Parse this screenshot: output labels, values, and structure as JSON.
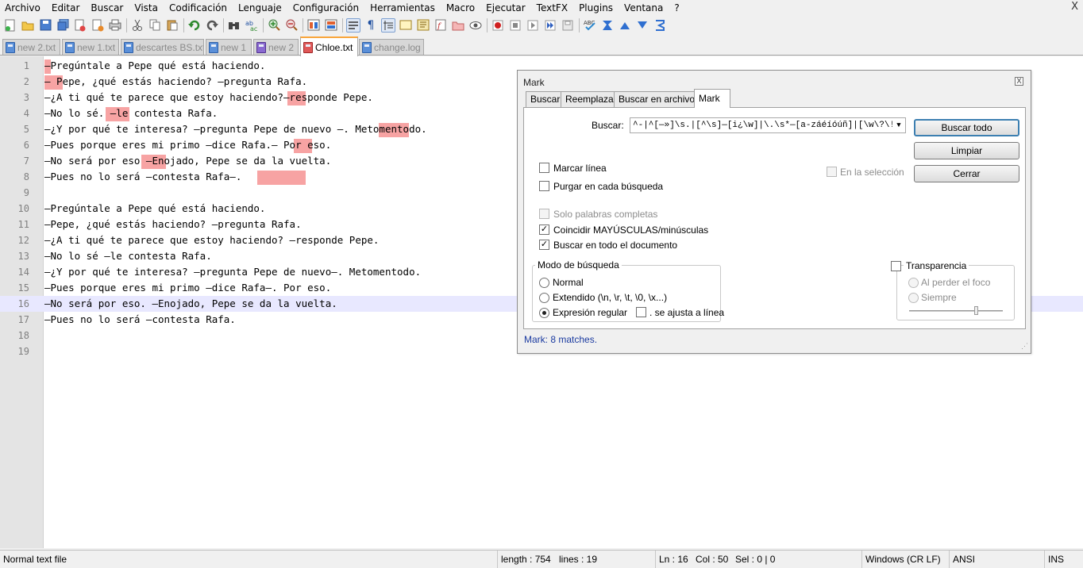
{
  "menu": [
    "Archivo",
    "Editar",
    "Buscar",
    "Vista",
    "Codificación",
    "Lenguaje",
    "Configuración",
    "Herramientas",
    "Macro",
    "Ejecutar",
    "TextFX",
    "Plugins",
    "Ventana",
    "?"
  ],
  "window_close": "X",
  "tabs": [
    {
      "label": "new 2.txt",
      "active": false
    },
    {
      "label": "new 1.txt",
      "active": false
    },
    {
      "label": "descartes BS.txt",
      "active": false
    },
    {
      "label": "new 1",
      "active": false
    },
    {
      "label": "new 2",
      "active": false
    },
    {
      "label": "Chloe.txt",
      "active": true
    },
    {
      "label": "change.log",
      "active": false
    }
  ],
  "editor": {
    "current_line": 16,
    "lines": [
      {
        "n": "1",
        "text": "—Pregúntale a Pepe qué está haciendo."
      },
      {
        "n": "2",
        "text": "— Pepe, ¿qué estás haciendo? —pregunta Rafa."
      },
      {
        "n": "3",
        "text": "—¿A ti qué te parece que estoy haciendo?—responde Pepe."
      },
      {
        "n": "4",
        "text": "—No lo sé. —le contesta Rafa."
      },
      {
        "n": "5",
        "text": "—¿Y por qué te interesa? —pregunta Pepe de nuevo —. Metomentodo."
      },
      {
        "n": "6",
        "text": "—Pues porque eres mi primo —dice Rafa.— Por eso."
      },
      {
        "n": "7",
        "text": "—No será por eso —Enojado, Pepe se da la vuelta."
      },
      {
        "n": "8",
        "text": "—Pues no lo será —contesta Rafa—.    "
      },
      {
        "n": "9",
        "text": ""
      },
      {
        "n": "10",
        "text": "—Pregúntale a Pepe qué está haciendo."
      },
      {
        "n": "11",
        "text": "—Pepe, ¿qué estás haciendo? —pregunta Rafa."
      },
      {
        "n": "12",
        "text": "—¿A ti qué te parece que estoy haciendo? —responde Pepe."
      },
      {
        "n": "13",
        "text": "—No lo sé —le contesta Rafa."
      },
      {
        "n": "14",
        "text": "—¿Y por qué te interesa? —pregunta Pepe de nuevo—. Metomentodo."
      },
      {
        "n": "15",
        "text": "—Pues porque eres mi primo —dice Rafa—. Por eso."
      },
      {
        "n": "16",
        "text": "—No será por eso. —Enojado, Pepe se da la vuelta."
      },
      {
        "n": "17",
        "text": "—Pues no lo será —contesta Rafa."
      },
      {
        "n": "18",
        "text": ""
      },
      {
        "n": "19",
        "text": ""
      }
    ],
    "marks_color": "#f7a3a3"
  },
  "dialog": {
    "title": "Mark",
    "close": "X",
    "tabs": [
      "Buscar",
      "Reemplazar",
      "Buscar en archivos",
      "Mark"
    ],
    "active_tab": "Mark",
    "find_label": "Buscar:",
    "find_value": "^-|^[—»]\\s.|[^\\s]—[i¿\\w]|\\.\\s*—[a-záéíóúñ]|[\\w\\?\\!]\\s+—[\\.:;,\\s",
    "buttons": {
      "find_all": "Buscar todo",
      "clear": "Limpiar",
      "close": "Cerrar"
    },
    "checks": {
      "bookmark_line": {
        "label": "Marcar línea",
        "checked": false
      },
      "purge": {
        "label": "Purgar en cada búsqueda",
        "checked": false
      },
      "in_selection": {
        "label": "En la selección",
        "checked": false
      },
      "whole_word": {
        "label": "Solo palabras completas",
        "checked": false
      },
      "match_case": {
        "label": "Coincidir MAYÚSCULAS/minúsculas",
        "checked": true
      },
      "wrap": {
        "label": "Buscar en todo el documento",
        "checked": true
      },
      "dot_newline": {
        "label": ". se ajusta a línea",
        "checked": false
      },
      "transparency": {
        "label": "Transparencia",
        "checked": false
      }
    },
    "search_mode": {
      "title": "Modo de búsqueda",
      "normal": "Normal",
      "extended": "Extendido (\\n, \\r, \\t, \\0, \\x...)",
      "regex": "Expresión regular",
      "selected": "regex"
    },
    "transparency_opts": {
      "on_lose_focus": "Al perder el foco",
      "always": "Siempre"
    },
    "status": "Mark: 8 matches."
  },
  "status": {
    "file_type": "Normal text file",
    "length": "length : 754",
    "lines": "lines : 19",
    "ln": "Ln : 16",
    "col": "Col : 50",
    "sel": "Sel : 0 | 0",
    "eol": "Windows (CR LF)",
    "encoding": "ANSI",
    "mode": "INS"
  }
}
